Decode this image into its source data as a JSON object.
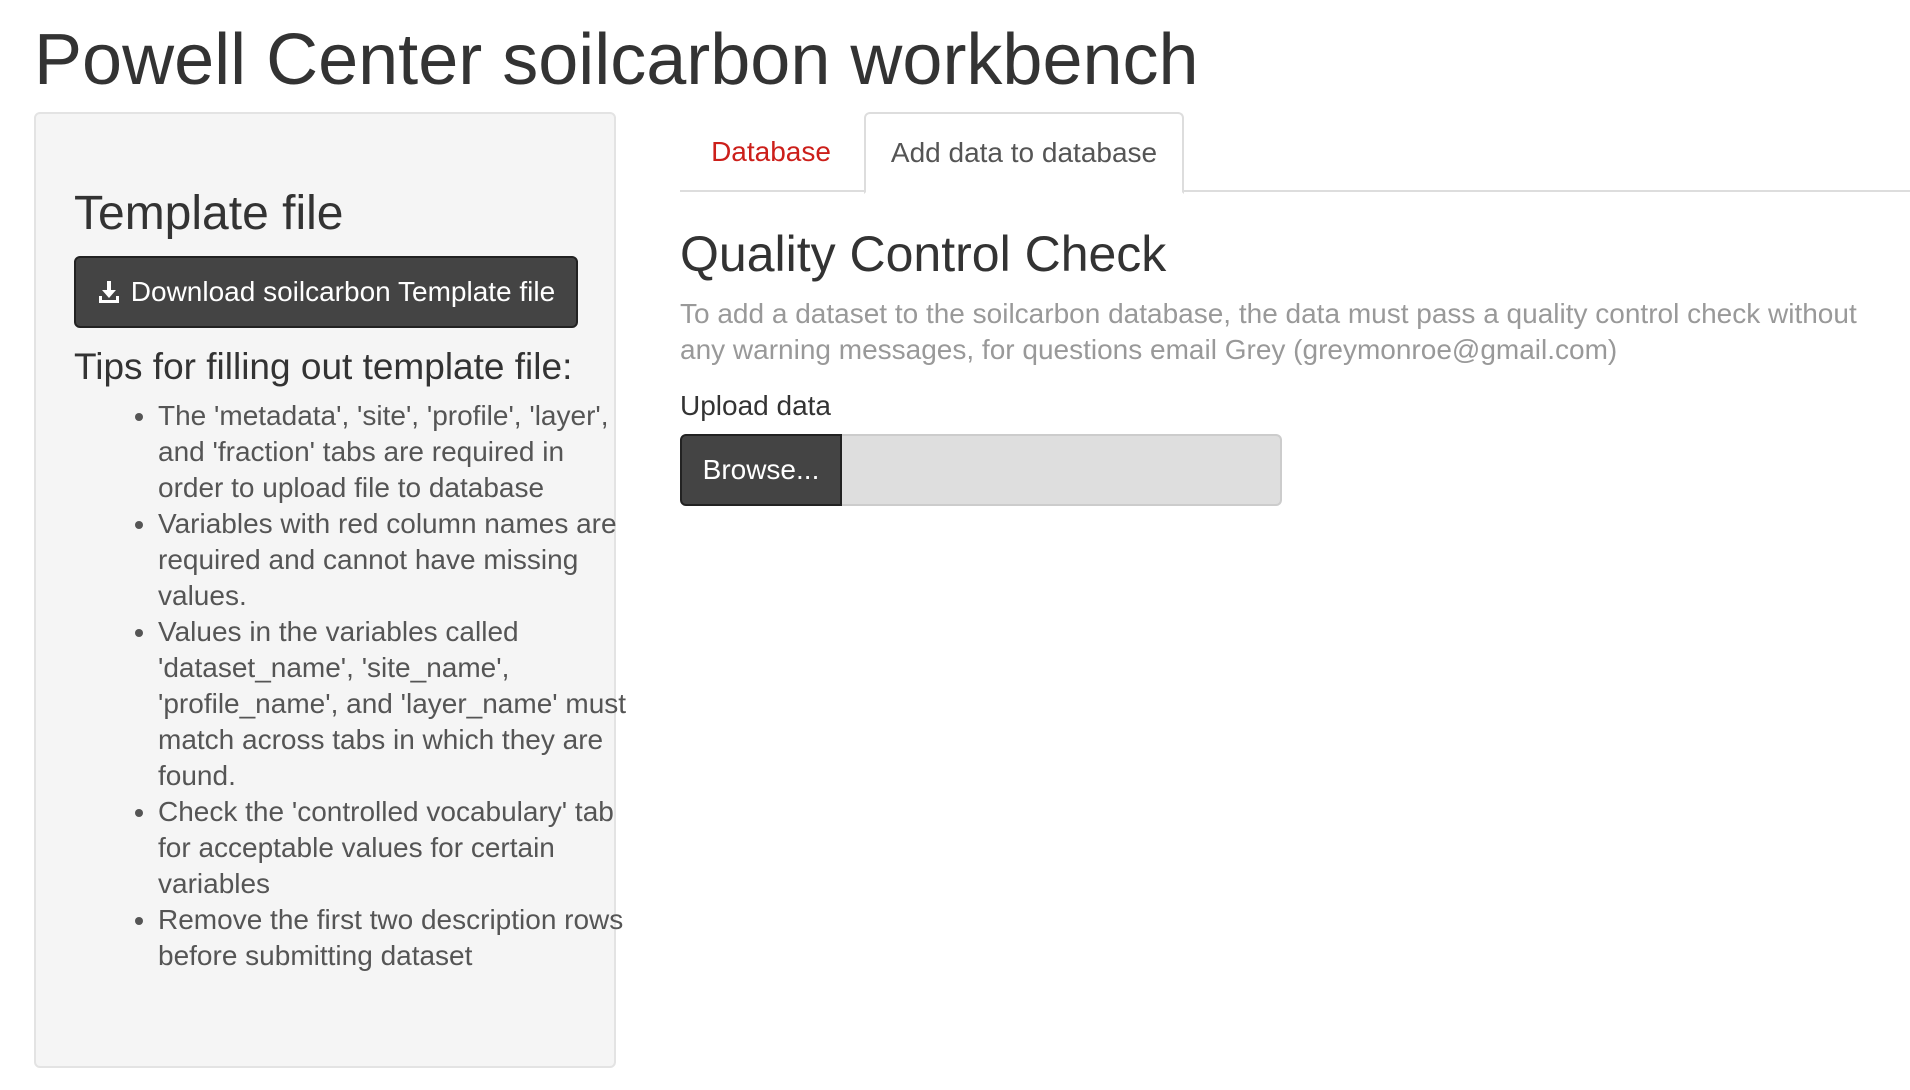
{
  "app": {
    "title": "Powell Center soilcarbon workbench"
  },
  "sidebar": {
    "heading": "Template file",
    "download_button": {
      "label": "Download soilcarbon Template file",
      "icon": "download-icon"
    },
    "tips_heading": "Tips for filling out template file:",
    "tips": [
      "The 'metadata', 'site', 'profile', 'layer', and 'fraction' tabs are required in order to upload file to database",
      "Variables with red column names are required and cannot have missing values.",
      "Values in the variables called 'dataset_name', 'site_name', 'profile_name', and 'layer_name' must match across tabs in which they are found.",
      "Check the 'controlled vocabulary' tab for acceptable values for certain variables",
      "Remove the first two description rows before submitting dataset"
    ]
  },
  "tabs": [
    {
      "label": "Database",
      "active": false
    },
    {
      "label": "Add data to database",
      "active": true
    }
  ],
  "main": {
    "title": "Quality Control Check",
    "description": "To add a dataset to the soilcarbon database, the data must pass a quality control check without any warning messages, for questions email Grey (greymonroe@gmail.com)",
    "upload": {
      "label": "Upload data",
      "browse_label": "Browse...",
      "file_value": ""
    }
  },
  "colors": {
    "sidebar_background": "#f5f5f5",
    "button_background": "#444444",
    "inactive_tab_text": "#cc1f1a",
    "muted_text": "#999999",
    "file_display_background": "#dedede"
  }
}
